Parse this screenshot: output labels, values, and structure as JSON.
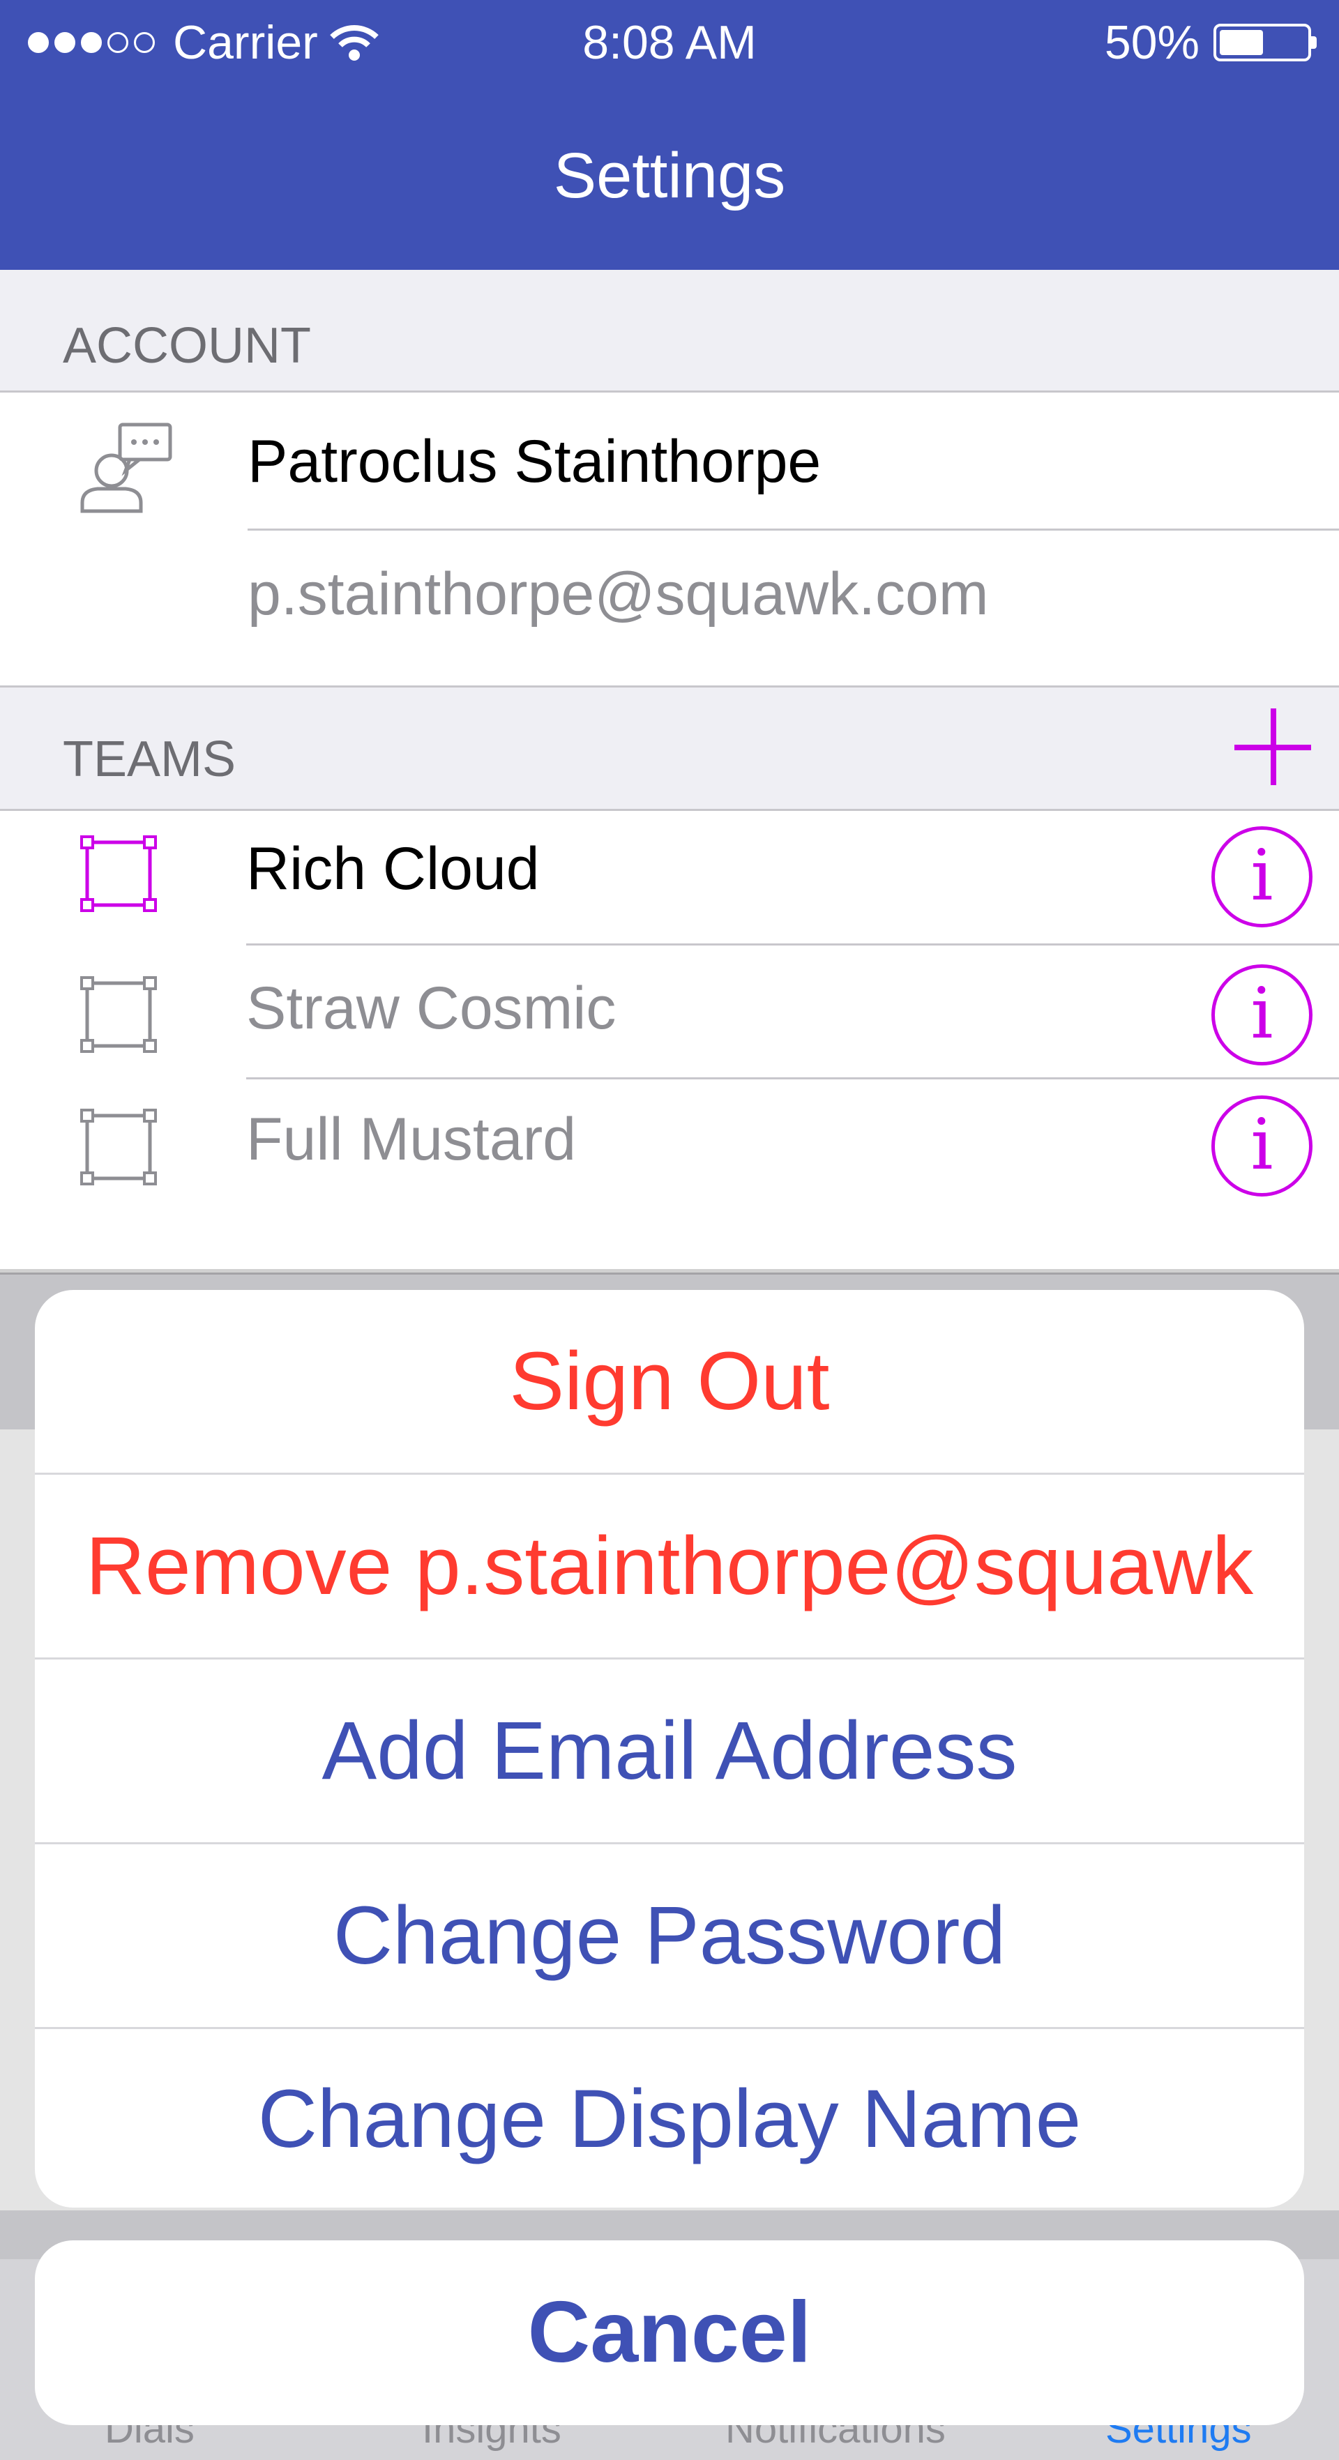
{
  "status_bar": {
    "carrier": "Carrier",
    "time": "8:08 AM",
    "battery": "50%",
    "signal_bars_filled": 3,
    "signal_bars_total": 5,
    "battery_level": 0.5
  },
  "header": {
    "title": "Settings"
  },
  "account": {
    "section_label": "ACCOUNT",
    "name": "Patroclus Stainthorpe",
    "email": "p.stainthorpe@squawk.com"
  },
  "teams": {
    "section_label": "TEAMS",
    "items": [
      {
        "name": "Rich Cloud",
        "active": true
      },
      {
        "name": "Straw Cosmic",
        "active": false
      },
      {
        "name": "Full Mustard",
        "active": false
      }
    ]
  },
  "tab_bar": {
    "items": [
      "Dials",
      "Insights",
      "Notifications",
      "Settings"
    ]
  },
  "action_sheet": {
    "sign_out": "Sign Out",
    "remove_email": "Remove p.stainthorpe@squawk",
    "add_email": "Add Email Address",
    "change_password": "Change Password",
    "change_display_name": "Change Display Name",
    "cancel": "Cancel"
  },
  "colors": {
    "primary": "#3f51b5",
    "accent": "#cc00e8",
    "destructive": "#ff3b30"
  }
}
